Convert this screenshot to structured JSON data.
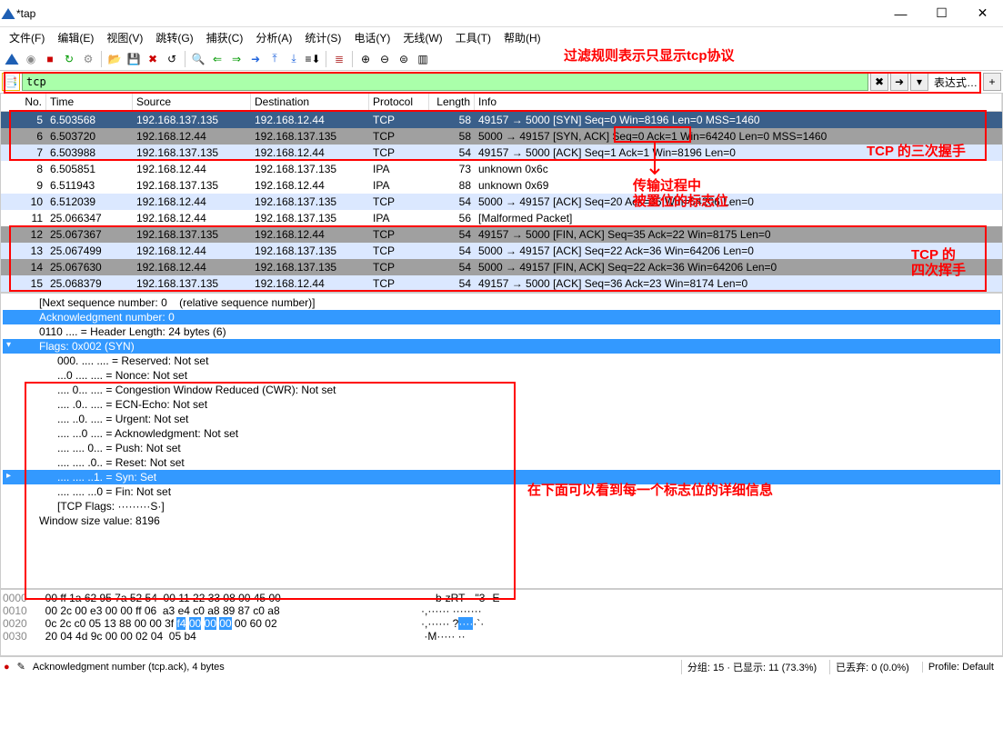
{
  "title": "*tap",
  "menu": [
    "文件(F)",
    "编辑(E)",
    "视图(V)",
    "跳转(G)",
    "捕获(C)",
    "分析(A)",
    "统计(S)",
    "电话(Y)",
    "无线(W)",
    "工具(T)",
    "帮助(H)"
  ],
  "filter_value": "tcp",
  "filter_expr": "表达式…",
  "annot": {
    "top": "过滤规则表示只显示tcp协议",
    "handshake": "TCP 的三次握手",
    "trans": "传输过程中\n被置位的标志位",
    "wave": "TCP 的\n四次挥手",
    "detail": "在下面可以看到每一个标志位的详细信息"
  },
  "columns": {
    "no": "No.",
    "time": "Time",
    "src": "Source",
    "dst": "Destination",
    "proto": "Protocol",
    "len": "Length",
    "info": "Info"
  },
  "packets": [
    {
      "no": 5,
      "time": "6.503568",
      "src": "192.168.137.135",
      "dst": "192.168.12.44",
      "proto": "TCP",
      "len": "58",
      "info": "49157 → 5000 [SYN] Seq=0 Win=8196 Len=0 MSS=1460",
      "cls": "r-sel"
    },
    {
      "no": 6,
      "time": "6.503720",
      "src": "192.168.12.44",
      "dst": "192.168.137.135",
      "proto": "TCP",
      "len": "58",
      "info": "5000 → 49157 [SYN, ACK] Seq=0 Ack=1 Win=64240 Len=0 MSS=1460",
      "cls": "r-gray"
    },
    {
      "no": 7,
      "time": "6.503988",
      "src": "192.168.137.135",
      "dst": "192.168.12.44",
      "proto": "TCP",
      "len": "54",
      "info": "49157 → 5000 [ACK] Seq=1 Ack=1 Win=8196 Len=0",
      "cls": "r-blue"
    },
    {
      "no": 8,
      "time": "6.505851",
      "src": "192.168.12.44",
      "dst": "192.168.137.135",
      "proto": "IPA",
      "len": "73",
      "info": "unknown 0x6c",
      "cls": "r-white"
    },
    {
      "no": 9,
      "time": "6.511943",
      "src": "192.168.137.135",
      "dst": "192.168.12.44",
      "proto": "IPA",
      "len": "88",
      "info": "unknown 0x69",
      "cls": "r-white"
    },
    {
      "no": 10,
      "time": "6.512039",
      "src": "192.168.12.44",
      "dst": "192.168.137.135",
      "proto": "TCP",
      "len": "54",
      "info": "5000 → 49157 [ACK] Seq=20 Ack=35 Win=64206 Len=0",
      "cls": "r-blue"
    },
    {
      "no": 11,
      "time": "25.066347",
      "src": "192.168.12.44",
      "dst": "192.168.137.135",
      "proto": "IPA",
      "len": "56",
      "info": "[Malformed Packet]",
      "cls": "r-white"
    },
    {
      "no": 12,
      "time": "25.067367",
      "src": "192.168.137.135",
      "dst": "192.168.12.44",
      "proto": "TCP",
      "len": "54",
      "info": "49157 → 5000 [FIN, ACK] Seq=35 Ack=22 Win=8175 Len=0",
      "cls": "r-gray"
    },
    {
      "no": 13,
      "time": "25.067499",
      "src": "192.168.12.44",
      "dst": "192.168.137.135",
      "proto": "TCP",
      "len": "54",
      "info": "5000 → 49157 [ACK] Seq=22 Ack=36 Win=64206 Len=0",
      "cls": "r-blue"
    },
    {
      "no": 14,
      "time": "25.067630",
      "src": "192.168.12.44",
      "dst": "192.168.137.135",
      "proto": "TCP",
      "len": "54",
      "info": "5000 → 49157 [FIN, ACK] Seq=22 Ack=36 Win=64206 Len=0",
      "cls": "r-gray"
    },
    {
      "no": 15,
      "time": "25.068379",
      "src": "192.168.137.135",
      "dst": "192.168.12.44",
      "proto": "TCP",
      "len": "54",
      "info": "49157 → 5000 [ACK] Seq=36 Ack=23 Win=8174 Len=0",
      "cls": "r-blue"
    }
  ],
  "details": [
    {
      "txt": "[Next sequence number: 0    (relative sequence number)]",
      "ind": 1,
      "cls": ""
    },
    {
      "txt": "Acknowledgment number: 0",
      "ind": 1,
      "cls": "sel"
    },
    {
      "txt": "0110 .... = Header Length: 24 bytes (6)",
      "ind": 1,
      "cls": ""
    },
    {
      "txt": "Flags: 0x002 (SYN)",
      "ind": 1,
      "cls": "sel",
      "exp": "v"
    },
    {
      "txt": "000. .... .... = Reserved: Not set",
      "ind": 2,
      "cls": ""
    },
    {
      "txt": "...0 .... .... = Nonce: Not set",
      "ind": 2,
      "cls": ""
    },
    {
      "txt": ".... 0... .... = Congestion Window Reduced (CWR): Not set",
      "ind": 2,
      "cls": ""
    },
    {
      "txt": ".... .0.. .... = ECN-Echo: Not set",
      "ind": 2,
      "cls": ""
    },
    {
      "txt": ".... ..0. .... = Urgent: Not set",
      "ind": 2,
      "cls": ""
    },
    {
      "txt": ".... ...0 .... = Acknowledgment: Not set",
      "ind": 2,
      "cls": ""
    },
    {
      "txt": ".... .... 0... = Push: Not set",
      "ind": 2,
      "cls": ""
    },
    {
      "txt": ".... .... .0.. = Reset: Not set",
      "ind": 2,
      "cls": ""
    },
    {
      "txt": ".... .... ..1. = Syn: Set",
      "ind": 2,
      "cls": "sel",
      "exp": ">"
    },
    {
      "txt": ".... .... ...0 = Fin: Not set",
      "ind": 2,
      "cls": ""
    },
    {
      "txt": "[TCP Flags: ·········S·]",
      "ind": 2,
      "cls": ""
    },
    {
      "txt": "Window size value: 8196",
      "ind": 1,
      "cls": ""
    }
  ],
  "hex": [
    {
      "off": "0000",
      "bytes": "00 ff 1a 62 95 7a 52 54  00 11 22 33 08 00 45 00",
      "ascii": "····b·zRT ··\"3··E·"
    },
    {
      "off": "0010",
      "bytes": "00 2c 00 e3 00 00 ff 06  a3 e4 c0 a8 89 87 c0 a8",
      "ascii": "·,······ ········"
    },
    {
      "off": "0020",
      "bytes": "0c 2c c0 05 13 88 00 00  3f f4 00 00 00 00 60 02",
      "ascii": "·,······ ?·····`·",
      "hl": [
        9,
        12
      ]
    },
    {
      "off": "0030",
      "bytes": "20 04 4d 9c 00 00 02 04  05 b4",
      "ascii": " ·M····· ··"
    }
  ],
  "status": {
    "field": "Acknowledgment number (tcp.ack), 4 bytes",
    "pkts": "分组: 15 · 已显示: 11 (73.3%)",
    "drop": "已丢弃: 0 (0.0%)",
    "profile": "Profile: Default"
  }
}
